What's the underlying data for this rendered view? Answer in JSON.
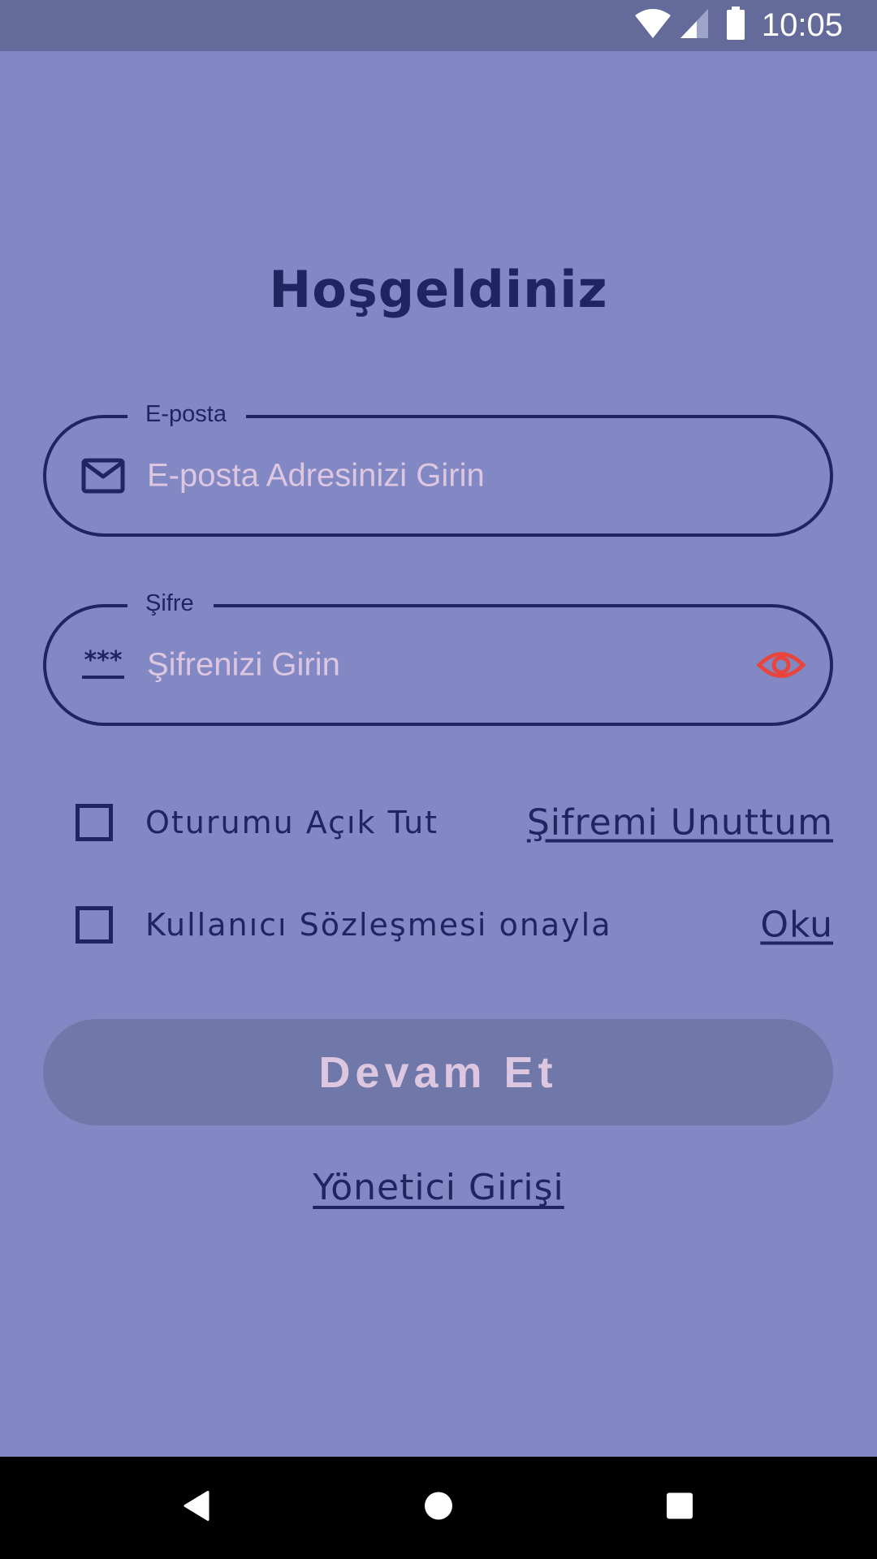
{
  "status_bar": {
    "time": "10:05",
    "icons": [
      "wifi-icon",
      "cell-signal-icon",
      "battery-icon"
    ]
  },
  "login": {
    "title": "Hoşgeldiniz",
    "email": {
      "label": "E-posta",
      "placeholder": "E-posta Adresinizi Girin",
      "icon": "mail-icon"
    },
    "password": {
      "label": "Şifre",
      "placeholder": "Şifrenizi Girin",
      "icon": "password-icon",
      "toggle_icon": "eye-icon"
    },
    "keep_session": {
      "label": "Oturumu Açık Tut",
      "checked": false
    },
    "forgot_password": "Şifremi Unuttum",
    "agreement": {
      "label": "Kullanıcı Sözleşmesi onayla",
      "checked": false
    },
    "read_link": "Oku",
    "continue_label": "Devam Et",
    "admin_login": "Yönetici Girişi"
  },
  "colors": {
    "background": "#8288c4",
    "status_bar": "#646a9a",
    "primary_text": "#1f2560",
    "placeholder": "#dcc6e0",
    "button_bg": "#7077a9",
    "eye_icon": "#e8453c"
  },
  "nav_bar": {
    "buttons": [
      "back-icon",
      "home-icon",
      "recents-icon"
    ]
  }
}
